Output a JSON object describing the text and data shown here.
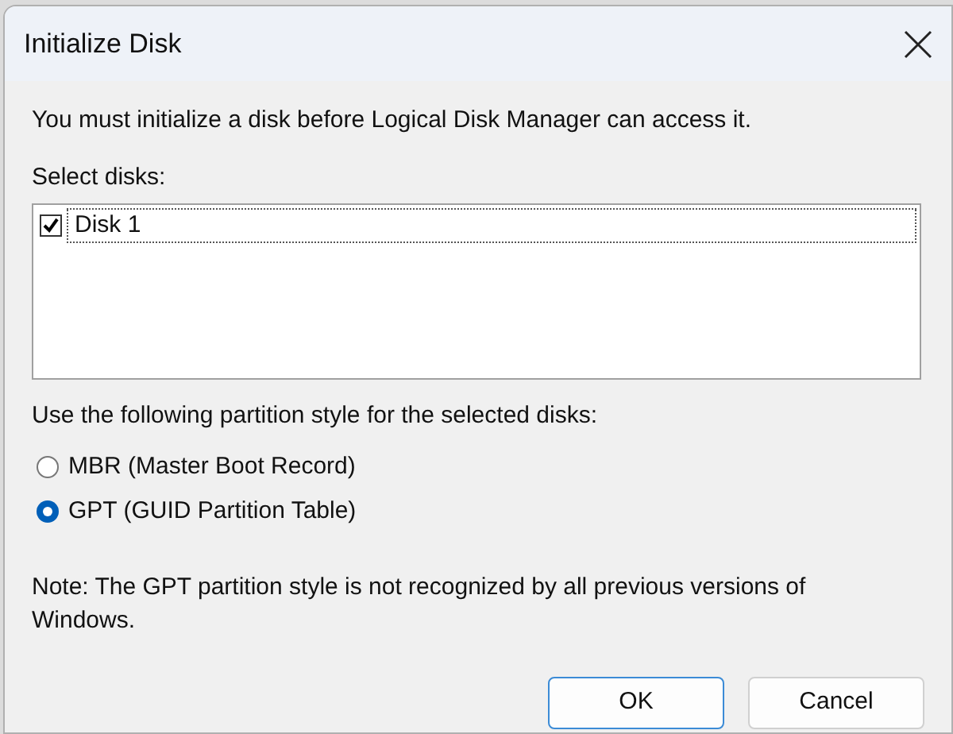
{
  "window": {
    "title": "Initialize Disk"
  },
  "message": "You must initialize a disk before Logical Disk Manager can access it.",
  "disks_label": "Select disks:",
  "disks": [
    {
      "label": "Disk 1",
      "checked": true
    }
  ],
  "partition_label": "Use the following partition style for the selected disks:",
  "partition_styles": [
    {
      "label": "MBR (Master Boot Record)",
      "selected": false
    },
    {
      "label": "GPT (GUID Partition Table)",
      "selected": true
    }
  ],
  "note": "Note: The GPT partition style is not recognized by all previous versions of Windows.",
  "buttons": [
    {
      "label": "OK",
      "kind": "default"
    },
    {
      "label": "Cancel",
      "kind": "normal"
    }
  ]
}
